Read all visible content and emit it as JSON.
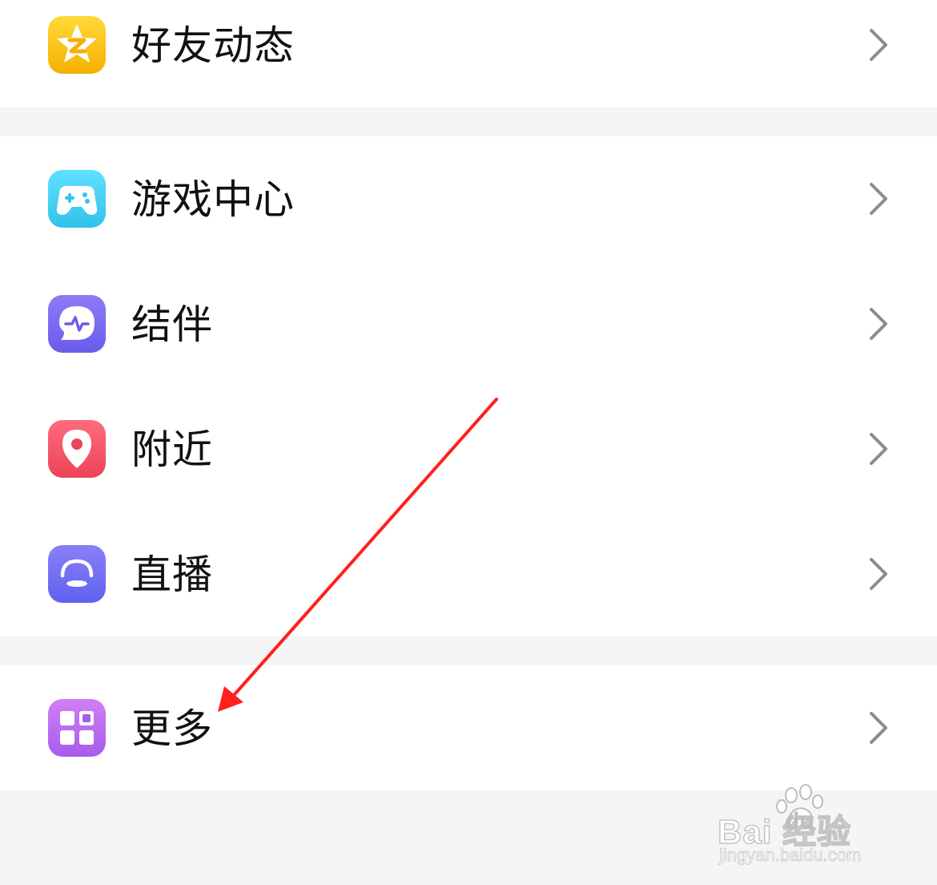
{
  "menu": {
    "items": [
      {
        "label": "好友动态",
        "icon": "qzone-star-icon",
        "color": "#f7b500"
      },
      {
        "label": "游戏中心",
        "icon": "gamepad-icon",
        "color": "#3ecbf0"
      },
      {
        "label": "结伴",
        "icon": "chat-pulse-icon",
        "color": "#7a6af0"
      },
      {
        "label": "附近",
        "icon": "location-pin-icon",
        "color": "#f2506a"
      },
      {
        "label": "直播",
        "icon": "live-icon",
        "color": "#6e6ef5"
      },
      {
        "label": "更多",
        "icon": "grid-icon",
        "color": "#b96cf0"
      }
    ],
    "chevron_icon": "chevron-right-icon"
  },
  "annotation": {
    "arrow_color": "#ff2020"
  },
  "watermark": {
    "brand": "Bai  经验",
    "brand_suffix": "du",
    "url": "jingyan.baidu.com"
  }
}
